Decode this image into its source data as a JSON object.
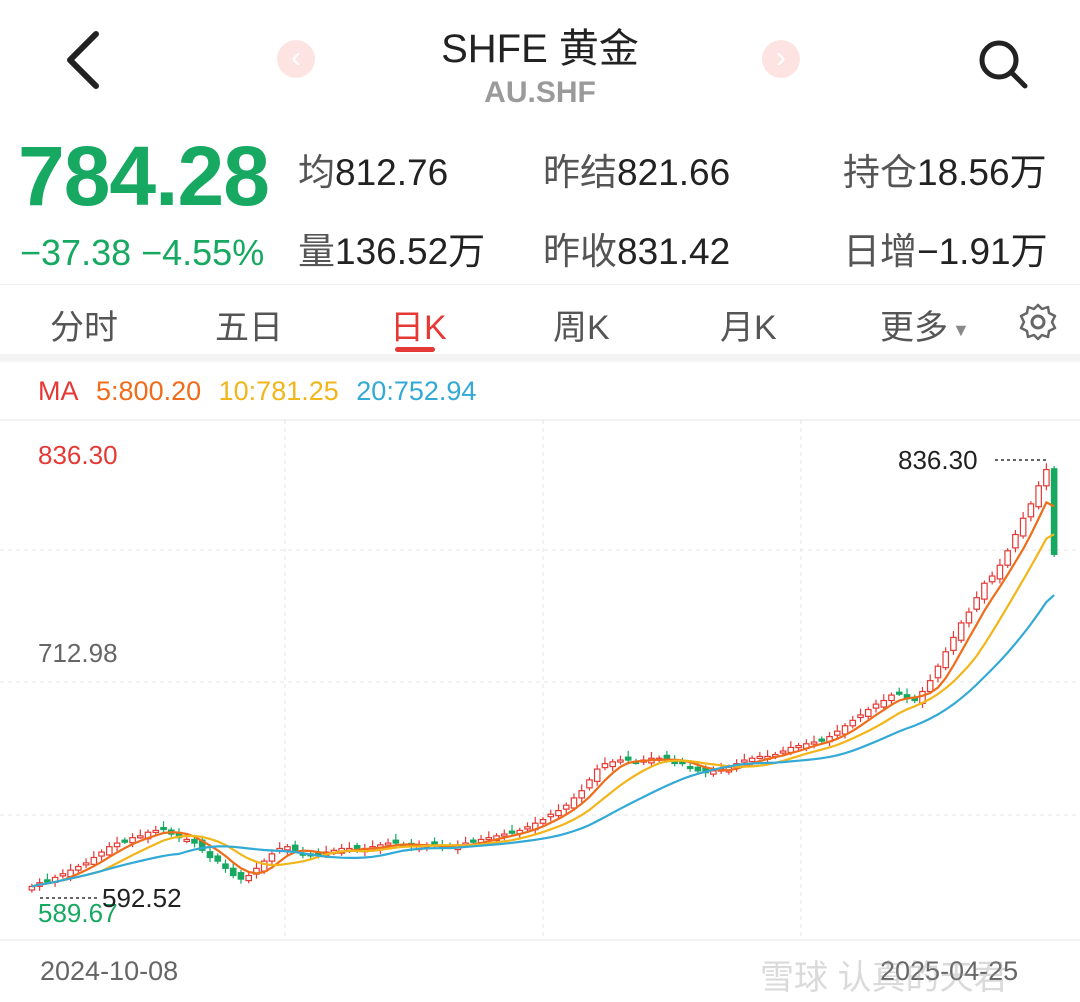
{
  "header": {
    "title": "SHFE 黄金",
    "subtitle": "AU.SHF",
    "prev_icon": "chevron-left-icon",
    "next_icon": "chevron-right-icon",
    "prev_glyph": "‹",
    "next_glyph": "›",
    "back_icon": "back-arrow-icon",
    "search_icon": "search-icon"
  },
  "quote": {
    "price": "784.28",
    "change": "−37.38  −4.55%",
    "color_down": "#17a861",
    "color_up": "#e53935",
    "stats": [
      {
        "label": "均",
        "value": "812.76"
      },
      {
        "label": "昨结",
        "value": "821.66"
      },
      {
        "label": "持仓",
        "value": "18.56万"
      },
      {
        "label": "量",
        "value": "136.52万"
      },
      {
        "label": "昨收",
        "value": "831.42"
      },
      {
        "label": "日增",
        "value": "−1.91万"
      }
    ]
  },
  "tabs": [
    {
      "label": "分时",
      "active": false
    },
    {
      "label": "五日",
      "active": false
    },
    {
      "label": "日K",
      "active": true
    },
    {
      "label": "周K",
      "active": false
    },
    {
      "label": "月K",
      "active": false
    },
    {
      "label": "更多",
      "active": false,
      "dropdown": true
    }
  ],
  "settings_icon": "gear-icon",
  "ma_legend": {
    "label": "MA",
    "ma5": "5:800.20",
    "ma10": "10:781.25",
    "ma20": "20:752.94",
    "colors": {
      "ma5": "#ef6c1a",
      "ma10": "#f2b51a",
      "ma20": "#33a9d6"
    }
  },
  "chart_data": {
    "type": "candlestick",
    "y_top_label": "836.30",
    "y_mid_label": "712.98",
    "y_bottom_label": "589.67",
    "ylim": [
      589.67,
      836.3
    ],
    "max_marker": "836.30",
    "min_marker": "592.52",
    "x_start": "2024-10-08",
    "x_end": "2025-04-25",
    "grid": true,
    "closes": [
      600,
      602,
      603,
      605,
      607,
      609,
      611,
      613,
      616,
      619,
      622,
      624,
      625,
      627,
      628,
      630,
      631,
      632,
      629,
      627,
      626,
      624,
      620,
      616,
      614,
      610,
      606,
      604,
      606,
      610,
      614,
      618,
      621,
      622,
      620,
      618,
      617,
      618,
      619,
      620,
      621,
      621,
      620,
      621,
      622,
      623,
      624,
      624,
      623,
      622,
      622,
      623,
      623,
      622,
      622,
      623,
      624,
      625,
      626,
      627,
      628,
      629,
      630,
      631,
      633,
      635,
      637,
      640,
      642,
      645,
      649,
      653,
      659,
      665,
      668,
      669,
      670,
      670,
      669,
      670,
      671,
      671,
      670,
      669,
      668,
      666,
      664,
      663,
      664,
      665,
      666,
      668,
      670,
      671,
      672,
      672,
      673,
      675,
      677,
      678,
      679,
      680,
      681,
      683,
      686,
      689,
      692,
      695,
      698,
      701,
      703,
      706,
      707,
      704,
      703,
      708,
      714,
      722,
      730,
      738,
      746,
      752,
      760,
      768,
      772,
      778,
      786,
      795,
      804,
      812,
      822,
      831,
      784
    ]
  },
  "watermark": "雪球 认真的天君"
}
